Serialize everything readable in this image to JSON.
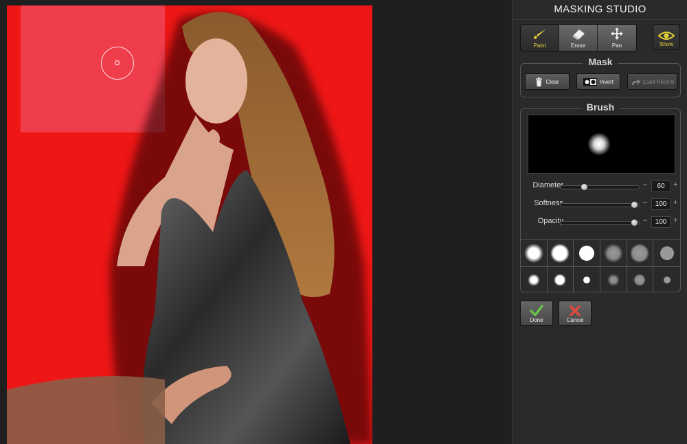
{
  "panel": {
    "title": "MASKING STUDIO",
    "tools": [
      {
        "label": "Paint",
        "icon": "paint-brush-icon",
        "active": true
      },
      {
        "label": "Erase",
        "icon": "eraser-icon",
        "active": false
      },
      {
        "label": "Pan",
        "icon": "pan-arrows-icon",
        "active": false
      }
    ],
    "show_label": "Show",
    "mask": {
      "title": "Mask",
      "clear_label": "Clear",
      "invert_label": "Invert",
      "load_recent_label": "Load Recent"
    },
    "brush": {
      "title": "Brush",
      "diameter_label": "Diameter",
      "diameter_value": "60",
      "diameter_fraction": 0.3,
      "softness_label": "Softness",
      "softness_value": "100",
      "softness_fraction": 0.94,
      "opacity_label": "Opacity",
      "opacity_value": "100",
      "opacity_fraction": 0.94,
      "minus": "–",
      "plus": "+"
    },
    "done_label": "Done",
    "cancel_label": "Cancel"
  },
  "colors": {
    "mask_red": "#ef1616",
    "active_tool": "#e6d23a",
    "done_green": "#6cc04a",
    "cancel_red": "#e04a3c"
  }
}
